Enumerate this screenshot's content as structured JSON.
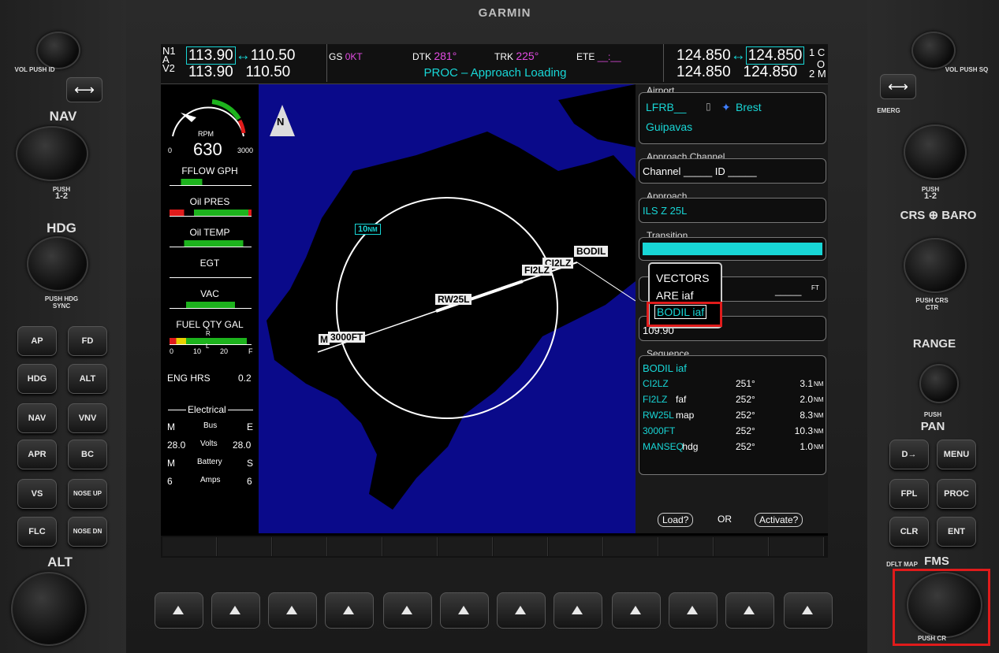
{
  "brand": "GARMIN",
  "nav": {
    "label_row1": "N",
    "label_row1b": "1",
    "label_row2": "A",
    "label_row3": "V",
    "label_row3b": "2",
    "nav1_active": "113.90",
    "nav1_standby": "110.50",
    "nav2_active": "113.90",
    "nav2_standby": "110.50"
  },
  "com": {
    "com1_standby": "124.850",
    "com1_active": "124.850",
    "com2_standby": "124.850",
    "com2_active": "124.850",
    "l1": "1",
    "l2": "C",
    "l3": "O",
    "l4": "2",
    "l5": "M"
  },
  "status": {
    "gs_label": "GS",
    "gs_value": "0KT",
    "dtk_label": "DTK",
    "dtk_value": "281°",
    "trk_label": "TRK",
    "trk_value": "225°",
    "ete_label": "ETE",
    "ete_value": "__:__",
    "message": "PROC – Approach Loading"
  },
  "engine": {
    "rpm_label": "RPM",
    "rpm_value": "630",
    "rpm_min": "0",
    "rpm_max": "3000",
    "fflow": "FFLOW GPH",
    "oil_pres": "Oil PRES",
    "oil_temp": "Oil TEMP",
    "egt": "EGT",
    "vac": "VAC",
    "fuel_qty": "FUEL QTY GAL",
    "fuel_r": "R",
    "fuel_l": "L",
    "fuel_0": "0",
    "fuel_10": "10",
    "fuel_20": "20",
    "fuel_f": "F",
    "eng_hrs_label": "ENG HRS",
    "eng_hrs_value": "0.2",
    "electrical": "Electrical",
    "m1": "M",
    "bus": "Bus",
    "e": "E",
    "volts_l": "28.0",
    "volts": "Volts",
    "volts_r": "28.0",
    "m2": "M",
    "battery": "Battery",
    "s": "S",
    "amps_l": "6",
    "amps": "Amps",
    "amps_r": "6"
  },
  "map": {
    "north": "N",
    "range": "10",
    "range_unit": "NM",
    "wpt_bodil": "BODIL",
    "wpt_ci2lz": "CI2LZ",
    "wpt_fi2lz": "FI2LZ",
    "wpt_rw25l": "RW25L",
    "wpt_3000ft": "3000FT",
    "wpt_m": "M"
  },
  "proc": {
    "airport_title": "Airport",
    "airport_id": "LFRB__",
    "airport_city": "Brest",
    "airport_name": "Guipavas",
    "channel_title": "Approach Channel",
    "channel_text": "Channel _____ ID _____",
    "approach_title": "Approach",
    "approach_value": "ILS Z 25L",
    "transition_title": "Transition",
    "minimums_value": "_____",
    "minimums_unit": "FT",
    "freq_value": "109.90",
    "dropdown": [
      "VECTORS",
      "ARE iaf",
      "BODIL iaf"
    ],
    "sequence_title": "Sequence",
    "sequence_head": "BODIL iaf",
    "sequence": [
      {
        "wpt": "CI2LZ",
        "sfx": "",
        "crs": "251°",
        "dist": "3.1",
        "unit": "NM"
      },
      {
        "wpt": "FI2LZ",
        "sfx": "faf",
        "crs": "252°",
        "dist": "2.0",
        "unit": "NM"
      },
      {
        "wpt": "RW25L",
        "sfx": "map",
        "crs": "252°",
        "dist": "8.3",
        "unit": "NM"
      },
      {
        "wpt": "3000FT",
        "sfx": "",
        "crs": "252°",
        "dist": "10.3",
        "unit": "NM"
      },
      {
        "wpt": "MANSEQ",
        "sfx": "hdg",
        "crs": "252°",
        "dist": "1.0",
        "unit": "NM"
      }
    ],
    "load": "Load?",
    "or": "OR",
    "activate": "Activate?"
  },
  "left": {
    "vol": "VOL",
    "push_id": "PUSH ID",
    "nav": "NAV",
    "push12": "PUSH",
    "one_two": "1-2",
    "hdg": "HDG",
    "push_hdg": "PUSH HDG SYNC",
    "ap": "AP",
    "fd": "FD",
    "hdg_btn": "HDG",
    "alt_btn": "ALT",
    "nav_btn": "NAV",
    "vnv": "VNV",
    "apr": "APR",
    "bc": "BC",
    "vs": "VS",
    "nose_up": "NOSE UP",
    "flc": "FLC",
    "nose_dn": "NOSE DN",
    "alt": "ALT"
  },
  "right": {
    "vol": "VOL",
    "push_sq": "PUSH SQ",
    "emerg": "EMERG",
    "push": "PUSH",
    "one_two": "1-2",
    "crs": "CRS",
    "baro": "BARO",
    "push_crs": "PUSH CRS CTR",
    "range": "RANGE",
    "push_pan": "PUSH",
    "pan": "PAN",
    "direct": "D→",
    "menu": "MENU",
    "fpl": "FPL",
    "proc_btn": "PROC",
    "clr": "CLR",
    "ent": "ENT",
    "dflt": "DFLT MAP",
    "fms": "FMS",
    "push_cr": "PUSH CR"
  },
  "colors": {
    "cyan": "#18d6d6",
    "magenta": "#e24ce2",
    "highlight_red": "#e01b1b",
    "map_water": "#0a0a8a"
  }
}
